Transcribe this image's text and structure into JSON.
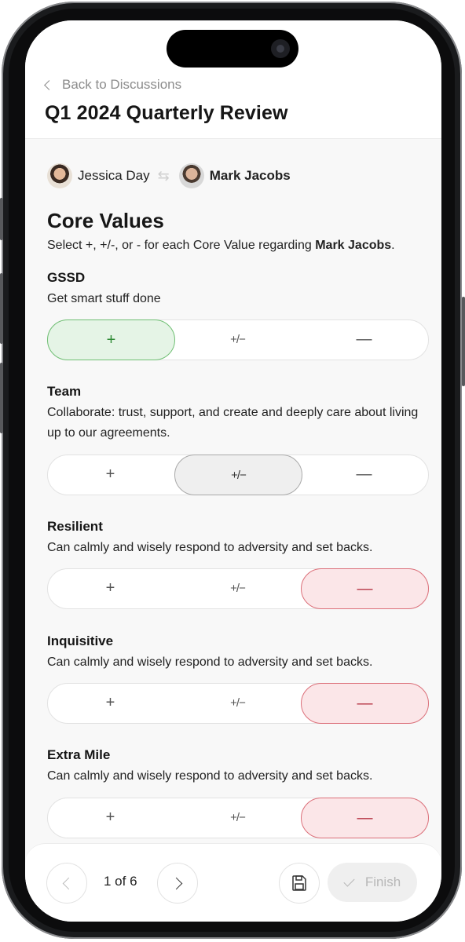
{
  "nav": {
    "back_label": "Back to Discussions",
    "title": "Q1 2024 Quarterly Review"
  },
  "participants": {
    "from": "Jessica Day",
    "to": "Mark Jacobs"
  },
  "section": {
    "title": "Core Values",
    "instruction_prefix": "Select +, +/-, or - for each Core Value regarding ",
    "instruction_name": "Mark Jacobs",
    "instruction_suffix": "."
  },
  "options": {
    "plus": "+",
    "mixed": "+/−",
    "minus": "—"
  },
  "core_values": [
    {
      "name": "GSSD",
      "description": "Get smart stuff done",
      "selected": "plus"
    },
    {
      "name": "Team",
      "description": "Collaborate: trust, support, and create and deeply care about living up to our agreements.",
      "selected": "mixed"
    },
    {
      "name": "Resilient",
      "description": "Can calmly and wisely respond to adversity and set backs.",
      "selected": "minus"
    },
    {
      "name": "Inquisitive",
      "description": "Can calmly and wisely respond to adversity and set backs.",
      "selected": "minus"
    },
    {
      "name": "Extra Mile",
      "description": "Can calmly and wisely respond to adversity and set backs.",
      "selected": "minus"
    }
  ],
  "footer": {
    "page_indicator": "1 of 6",
    "finish_label": "Finish"
  },
  "colors": {
    "plus": "#2f8a35",
    "minus": "#b63444",
    "mixed": "#333333"
  }
}
